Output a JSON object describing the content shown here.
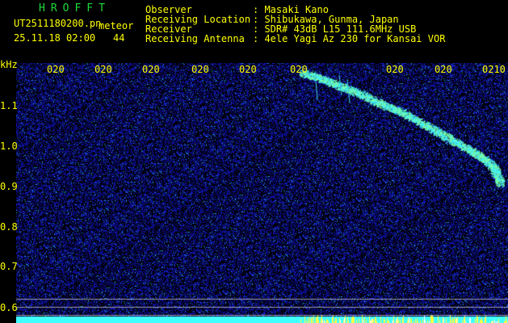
{
  "header": {
    "brand": "HROFFT",
    "filename": "UT2511180200.pn",
    "meteor_label": "meteor",
    "datetime": "25.11.18 02:00",
    "meteor_count": "44",
    "fields": [
      {
        "label": "Observer",
        "value": ": Masaki Kano"
      },
      {
        "label": "Receiving Location",
        "value": ": Shibukawa, Gunma, Japan"
      },
      {
        "label": "Receiver",
        "value": ": SDR# 43dB L15 111.6MHz USB"
      },
      {
        "label": "Receiving Antenna",
        "value": ": 4ele Yagi Az 230 for Kansai VOR"
      }
    ]
  },
  "time_ticks": [
    "020",
    "020",
    "020",
    "020",
    "020",
    "020",
    "020",
    "020",
    "0210"
  ],
  "y_axis": {
    "unit": "kHz",
    "labels": [
      "1.1",
      "1.0",
      "0.9",
      "0.8",
      "0.7",
      "0.6"
    ]
  },
  "colors": {
    "background": "#000000",
    "text": "#ffff00",
    "brand": "#1fdc3c",
    "noise_blue": "#2020c8",
    "signal_cyan": "#3ff0ff",
    "baseline": "#40ffff",
    "baseline_peaks": "#ffff40"
  }
}
